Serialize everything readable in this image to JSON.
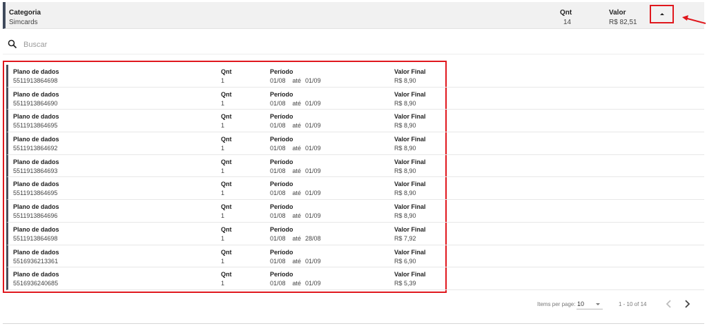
{
  "category": {
    "title_label": "Categoria",
    "value": "Simcards",
    "qnt_label": "Qnt",
    "qnt_value": "14",
    "valor_label": "Valor",
    "valor_value": "R$ 82,51"
  },
  "search": {
    "placeholder": "Buscar"
  },
  "item_labels": {
    "qnt": "Qnt",
    "periodo": "Período",
    "ate": "até",
    "valor_final": "Valor Final"
  },
  "items": [
    {
      "name": "Plano de dados",
      "number": "5511913864698",
      "qnt": "1",
      "start": "01/08",
      "end": "01/09",
      "valor": "R$ 8,90"
    },
    {
      "name": "Plano de dados",
      "number": "5511913864690",
      "qnt": "1",
      "start": "01/08",
      "end": "01/09",
      "valor": "R$ 8,90"
    },
    {
      "name": "Plano de dados",
      "number": "5511913864695",
      "qnt": "1",
      "start": "01/08",
      "end": "01/09",
      "valor": "R$ 8,90"
    },
    {
      "name": "Plano de dados",
      "number": "5511913864692",
      "qnt": "1",
      "start": "01/08",
      "end": "01/09",
      "valor": "R$ 8,90"
    },
    {
      "name": "Plano de dados",
      "number": "5511913864693",
      "qnt": "1",
      "start": "01/08",
      "end": "01/09",
      "valor": "R$ 8,90"
    },
    {
      "name": "Plano de dados",
      "number": "5511913864695",
      "qnt": "1",
      "start": "01/08",
      "end": "01/09",
      "valor": "R$ 8,90"
    },
    {
      "name": "Plano de dados",
      "number": "5511913864696",
      "qnt": "1",
      "start": "01/08",
      "end": "01/09",
      "valor": "R$ 8,90"
    },
    {
      "name": "Plano de dados",
      "number": "5511913864698",
      "qnt": "1",
      "start": "01/08",
      "end": "28/08",
      "valor": "R$ 7,92"
    },
    {
      "name": "Plano de dados",
      "number": "5516936213361",
      "qnt": "1",
      "start": "01/08",
      "end": "01/09",
      "valor": "R$ 6,90"
    },
    {
      "name": "Plano de dados",
      "number": "5516936240685",
      "qnt": "1",
      "start": "01/08",
      "end": "01/09",
      "valor": "R$ 5,39"
    }
  ],
  "paginator": {
    "items_per_page_label": "Items per page:",
    "items_per_page_value": "10",
    "range_label": "1 - 10 of 14"
  },
  "colors": {
    "highlight": "#e0161c",
    "accent_bar": "#3f4a5c"
  },
  "icons": {
    "collapse": "caret-up-icon",
    "search": "search-icon",
    "prev": "chevron-left-icon",
    "next": "chevron-right-icon"
  }
}
